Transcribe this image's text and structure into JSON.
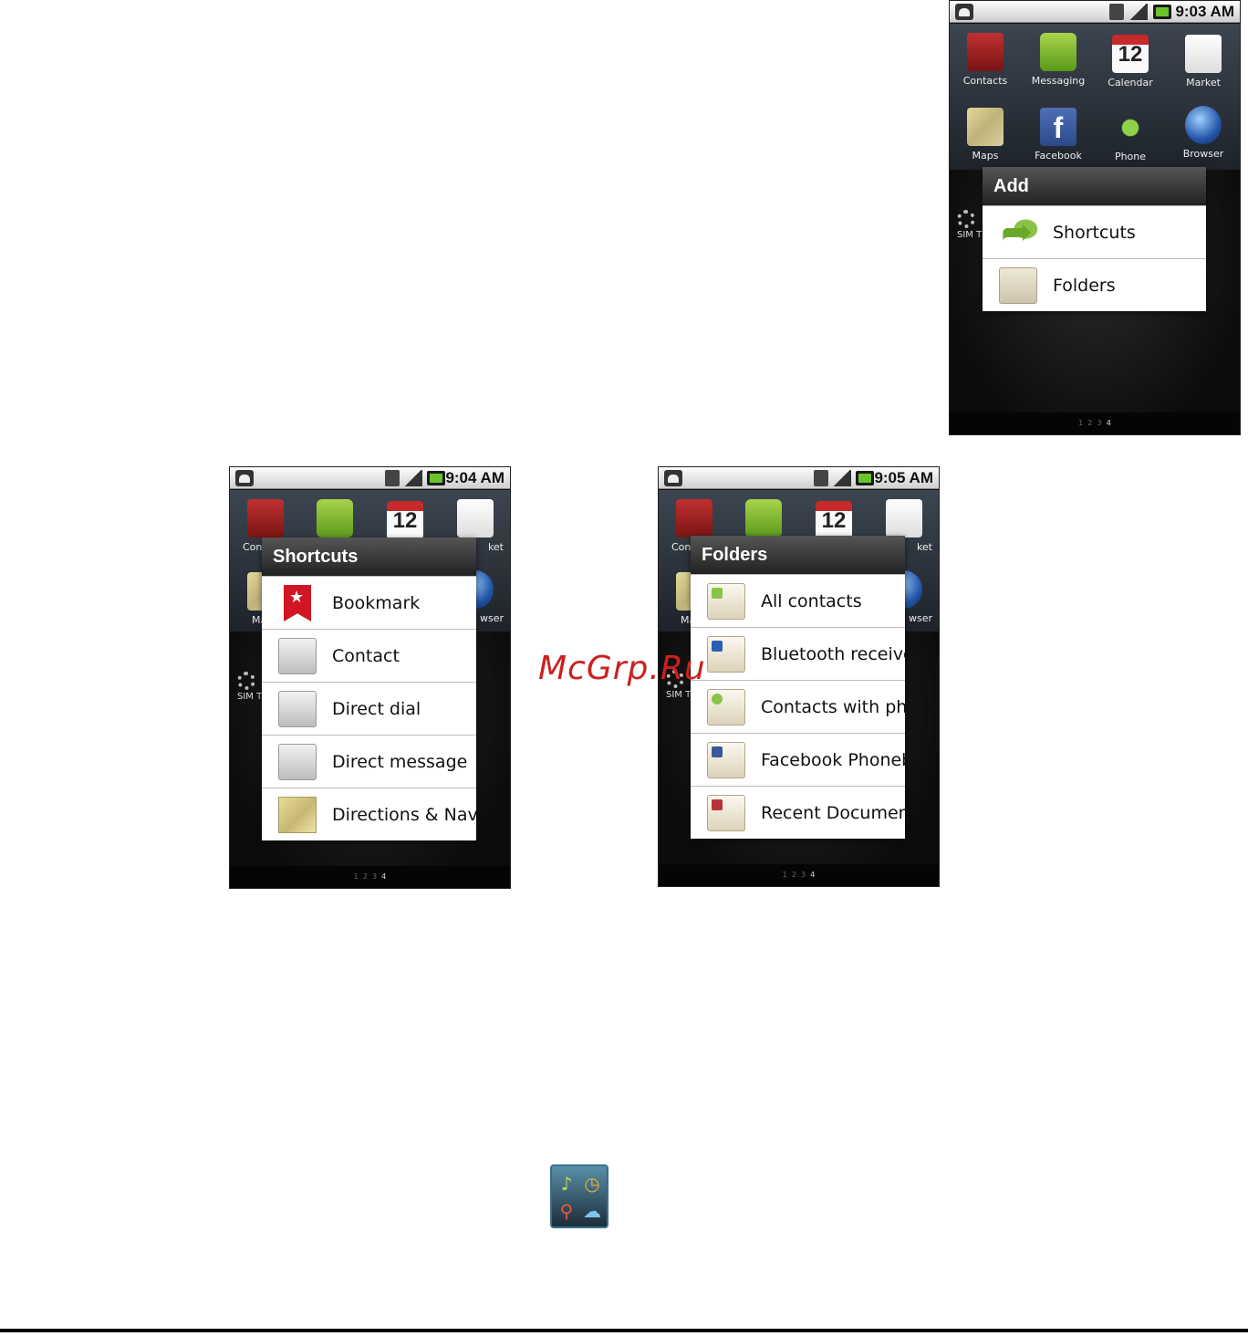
{
  "watermark": "McGrp.Ru",
  "nav_dots": {
    "pages": [
      "1",
      "2",
      "3"
    ],
    "current": "4"
  },
  "home_apps": {
    "contacts": "Contacts",
    "messaging": "Messaging",
    "calendar": "Calendar",
    "calendar_day": "12",
    "market": "Market",
    "maps": "Maps",
    "facebook": "Facebook",
    "facebook_letter": "f",
    "phone": "Phone",
    "browser": "Browser",
    "sim": "SIM T"
  },
  "partial_labels": {
    "contacts": "Con",
    "market": "ket",
    "maps": "Ma",
    "browser": "wser",
    "sim": "SIM T"
  },
  "screen_add": {
    "time": "9:03 AM",
    "title": "Add",
    "items": [
      "Shortcuts",
      "Folders"
    ]
  },
  "screen_shortcuts": {
    "time": "9:04 AM",
    "title": "Shortcuts",
    "items": [
      "Bookmark",
      "Contact",
      "Direct dial",
      "Direct message",
      "Directions & Navi"
    ]
  },
  "screen_folders": {
    "time": "9:05 AM",
    "title": "Folders",
    "items": [
      "All contacts",
      "Bluetooth receive",
      "Contacts with ph",
      "Facebook Phoneb",
      "Recent Documents"
    ]
  },
  "tools_icon": {
    "glyphs": [
      "♪",
      "◷",
      "⚲",
      "☁"
    ]
  }
}
